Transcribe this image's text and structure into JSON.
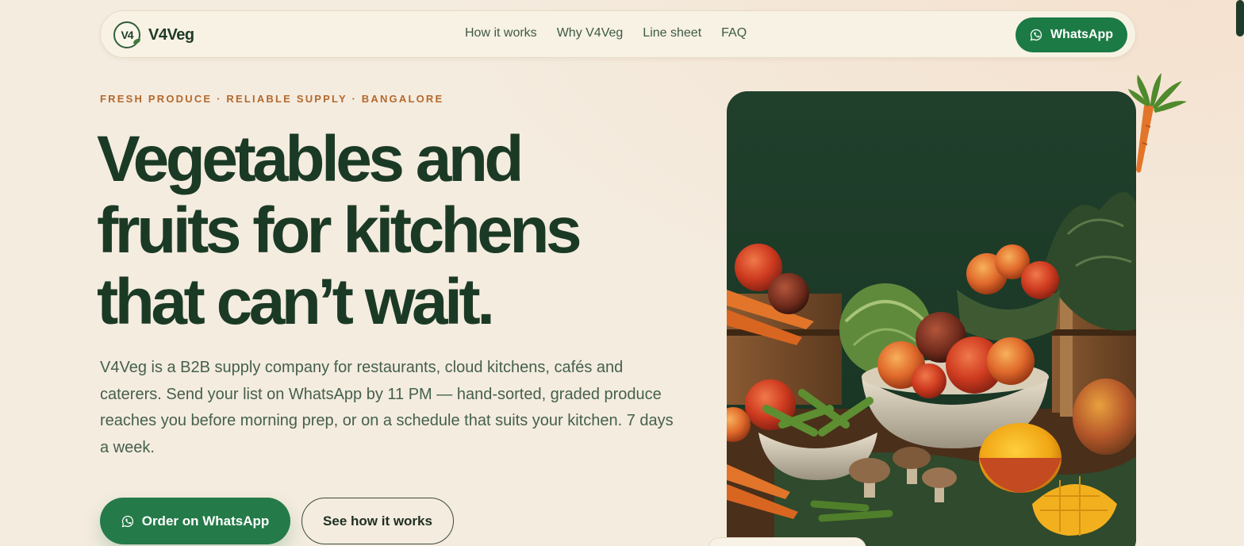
{
  "nav": {
    "logo_mark": "V4",
    "brand": "V4Veg",
    "links": [
      "How it works",
      "Why V4Veg",
      "Line sheet",
      "FAQ"
    ],
    "cta_label": "WhatsApp"
  },
  "hero": {
    "eyebrow": "FRESH PRODUCE · RELIABLE SUPPLY · BANGALORE",
    "headline_lines": [
      "Vegetables and",
      "fruits for kitchens",
      "that can’t wait."
    ],
    "lead": "V4Veg is a B2B supply company for restaurants, cloud kitchens, cafés and caterers. Send your list on WhatsApp by 11 PM — hand-sorted, graded produce reaches you before morning prep, or on a schedule that suits your kitchen. 7 days a week.",
    "primary_cta": "Order on WhatsApp",
    "secondary_cta": "See how it works"
  },
  "icons": {
    "whatsapp": "whatsapp-icon",
    "carrot": "carrot-icon"
  },
  "colors": {
    "background": "#f4ecdf",
    "primary_green": "#1c7a45",
    "headline": "#1b3a26",
    "eyebrow": "#b5682c"
  }
}
